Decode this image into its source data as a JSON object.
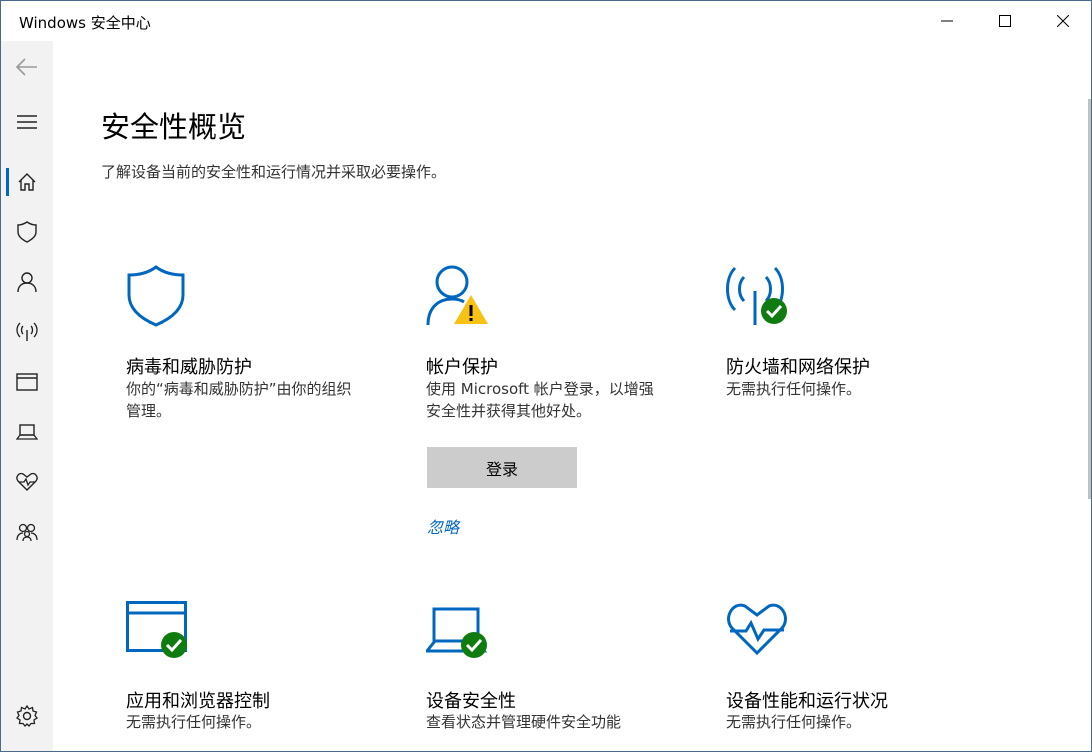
{
  "window": {
    "title": "Windows 安全中心"
  },
  "sidebar": {
    "items": [
      {
        "name": "back",
        "icon": "back-arrow-icon"
      },
      {
        "name": "menu",
        "icon": "hamburger-icon"
      },
      {
        "name": "home",
        "icon": "home-icon",
        "active": true
      },
      {
        "name": "virus",
        "icon": "shield-icon"
      },
      {
        "name": "account",
        "icon": "person-icon"
      },
      {
        "name": "firewall",
        "icon": "antenna-icon"
      },
      {
        "name": "app-browser",
        "icon": "browser-window-icon"
      },
      {
        "name": "device-security",
        "icon": "laptop-icon"
      },
      {
        "name": "device-health",
        "icon": "heartbeat-icon"
      },
      {
        "name": "family",
        "icon": "family-icon"
      },
      {
        "name": "settings",
        "icon": "gear-icon"
      }
    ]
  },
  "main": {
    "title": "安全性概览",
    "subtitle": "了解设备当前的安全性和运行情况并采取必要操作。",
    "tiles": [
      {
        "title": "病毒和威胁防护",
        "desc": "你的“病毒和威胁防护”由你的组织\n管理。",
        "icon": "shield-icon"
      },
      {
        "title": "帐户保护",
        "desc": "使用 Microsoft 帐户登录，以增强\n安全性并获得其他好处。",
        "icon": "account-warning-icon",
        "button": "登录",
        "link": "忽略"
      },
      {
        "title": "防火墙和网络保护",
        "desc": "无需执行任何操作。",
        "icon": "antenna-check-icon"
      },
      {
        "title": "应用和浏览器控制",
        "desc": "无需执行任何操作。",
        "icon": "browser-check-icon"
      },
      {
        "title": "设备安全性",
        "desc": "查看状态并管理硬件安全功能",
        "icon": "laptop-check-icon"
      },
      {
        "title": "设备性能和运行状况",
        "desc": "无需执行任何操作。",
        "icon": "heartbeat-icon"
      }
    ]
  },
  "colors": {
    "accent": "#0067c0",
    "success": "#107c10",
    "warning": "#f8c214"
  }
}
